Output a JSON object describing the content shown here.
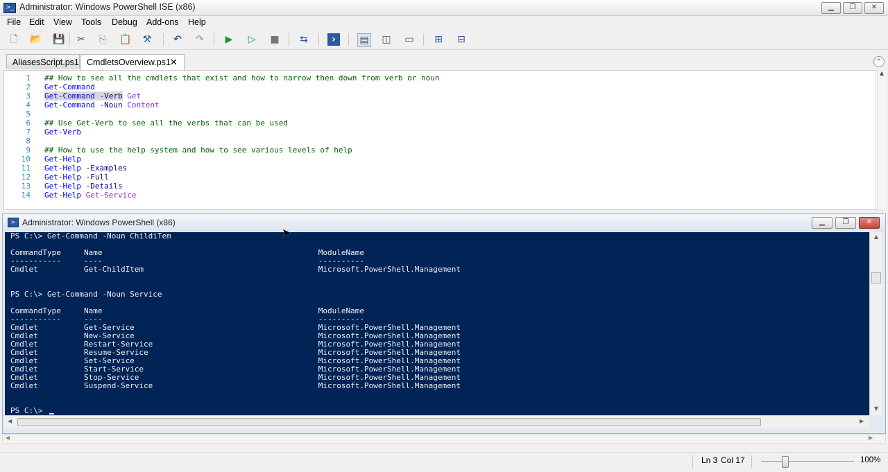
{
  "window": {
    "title": "Administrator: Windows PowerShell ISE (x86)",
    "min_glyph": "▁",
    "max_glyph": "❐",
    "close_glyph": "✕"
  },
  "menu": [
    "File",
    "Edit",
    "View",
    "Tools",
    "Debug",
    "Add-ons",
    "Help"
  ],
  "toolbar": [
    {
      "name": "new-file-icon",
      "glyph": "🗋"
    },
    {
      "name": "open-folder-icon",
      "glyph": "📂"
    },
    {
      "name": "save-icon",
      "glyph": "💾"
    },
    {
      "name": "cut-icon",
      "glyph": "✂"
    },
    {
      "name": "copy-icon",
      "glyph": "⎘"
    },
    {
      "name": "paste-icon",
      "glyph": "📋"
    },
    {
      "name": "clear-console-icon",
      "glyph": "⚒"
    },
    {
      "name": "undo-icon",
      "glyph": "↶"
    },
    {
      "name": "redo-icon",
      "glyph": "↷"
    },
    {
      "name": "run-script-icon",
      "glyph": "▶"
    },
    {
      "name": "run-selection-icon",
      "glyph": "▷"
    },
    {
      "name": "stop-icon",
      "glyph": "■"
    },
    {
      "name": "remote-powershell-icon",
      "glyph": "⇆"
    },
    {
      "name": "powershell-console-icon",
      "glyph": "›"
    },
    {
      "name": "layout-top-icon",
      "glyph": "▤"
    },
    {
      "name": "layout-right-icon",
      "glyph": "◫"
    },
    {
      "name": "layout-max-icon",
      "glyph": "▭"
    },
    {
      "name": "show-commands-icon",
      "glyph": "⊞"
    },
    {
      "name": "show-addons-icon",
      "glyph": "⊟"
    }
  ],
  "tabs": [
    {
      "label": "AliasesScript.ps1",
      "active": false
    },
    {
      "label": "CmdletsOverview.ps1",
      "active": true,
      "close": "✕"
    }
  ],
  "collapse_glyph": "⌃",
  "editor": {
    "lines": [
      {
        "n": "1",
        "tokens": [
          {
            "t": "## How to see all the cmdlets that exist and how to narrow then down from verb or noun",
            "c": "cmt"
          }
        ]
      },
      {
        "n": "2",
        "tokens": [
          {
            "t": "Get-Command",
            "c": "cmd"
          }
        ]
      },
      {
        "n": "3",
        "tokens": [
          {
            "t": "Get-Command",
            "c": "cmd sel"
          },
          {
            "t": " ",
            "c": "sel"
          },
          {
            "t": "-Verb",
            "c": "par sel"
          },
          {
            "t": " ",
            "c": ""
          },
          {
            "t": "Get",
            "c": "str"
          }
        ]
      },
      {
        "n": "4",
        "tokens": [
          {
            "t": "Get-Command",
            "c": "cmd"
          },
          {
            "t": " ",
            "c": ""
          },
          {
            "t": "-Noun",
            "c": "par"
          },
          {
            "t": " ",
            "c": ""
          },
          {
            "t": "Content",
            "c": "str"
          }
        ]
      },
      {
        "n": "5",
        "tokens": []
      },
      {
        "n": "6",
        "tokens": [
          {
            "t": "## Use Get-Verb to see all the verbs that can be used",
            "c": "cmt"
          }
        ]
      },
      {
        "n": "7",
        "tokens": [
          {
            "t": "Get-Verb",
            "c": "cmd"
          }
        ]
      },
      {
        "n": "8",
        "tokens": []
      },
      {
        "n": "9",
        "tokens": [
          {
            "t": "## How to use the help system and how to see various levels of help",
            "c": "cmt"
          }
        ]
      },
      {
        "n": "10",
        "tokens": [
          {
            "t": "Get-Help",
            "c": "cmd"
          }
        ]
      },
      {
        "n": "11",
        "tokens": [
          {
            "t": "Get-Help",
            "c": "cmd"
          },
          {
            "t": " ",
            "c": ""
          },
          {
            "t": "-Examples",
            "c": "par"
          }
        ]
      },
      {
        "n": "12",
        "tokens": [
          {
            "t": "Get-Help",
            "c": "cmd"
          },
          {
            "t": " ",
            "c": ""
          },
          {
            "t": "-Full",
            "c": "par"
          }
        ]
      },
      {
        "n": "13",
        "tokens": [
          {
            "t": "Get-Help",
            "c": "cmd"
          },
          {
            "t": " ",
            "c": ""
          },
          {
            "t": "-Details",
            "c": "par"
          }
        ]
      },
      {
        "n": "14",
        "tokens": [
          {
            "t": "Get-Help",
            "c": "cmd"
          },
          {
            "t": " ",
            "c": ""
          },
          {
            "t": "Get-Service",
            "c": "str"
          }
        ]
      }
    ]
  },
  "console_window": {
    "title": "Administrator: Windows PowerShell (x86)",
    "lines": [
      "PS C:\\> Get-Command -Noun ChildiTem",
      "",
      "CommandType     Name                                               ModuleName",
      "-----------     ----                                               ----------",
      "Cmdlet          Get-ChildItem                                      Microsoft.PowerShell.Management",
      "",
      "",
      "PS C:\\> Get-Command -Noun Service",
      "",
      "CommandType     Name                                               ModuleName",
      "-----------     ----                                               ----------",
      "Cmdlet          Get-Service                                        Microsoft.PowerShell.Management",
      "Cmdlet          New-Service                                        Microsoft.PowerShell.Management",
      "Cmdlet          Restart-Service                                    Microsoft.PowerShell.Management",
      "Cmdlet          Resume-Service                                     Microsoft.PowerShell.Management",
      "Cmdlet          Set-Service                                        Microsoft.PowerShell.Management",
      "Cmdlet          Start-Service                                      Microsoft.PowerShell.Management",
      "Cmdlet          Stop-Service                                       Microsoft.PowerShell.Management",
      "Cmdlet          Suspend-Service                                    Microsoft.PowerShell.Management",
      "",
      "",
      "PS C:\\> "
    ]
  },
  "status": {
    "line": "Ln 3",
    "col": "Col 17",
    "zoom": "100%",
    "zoom_level": 1.0
  },
  "colors": {
    "console_bg": "#012456",
    "console_fg": "#eeedf0",
    "close_red": "#c9443a"
  }
}
